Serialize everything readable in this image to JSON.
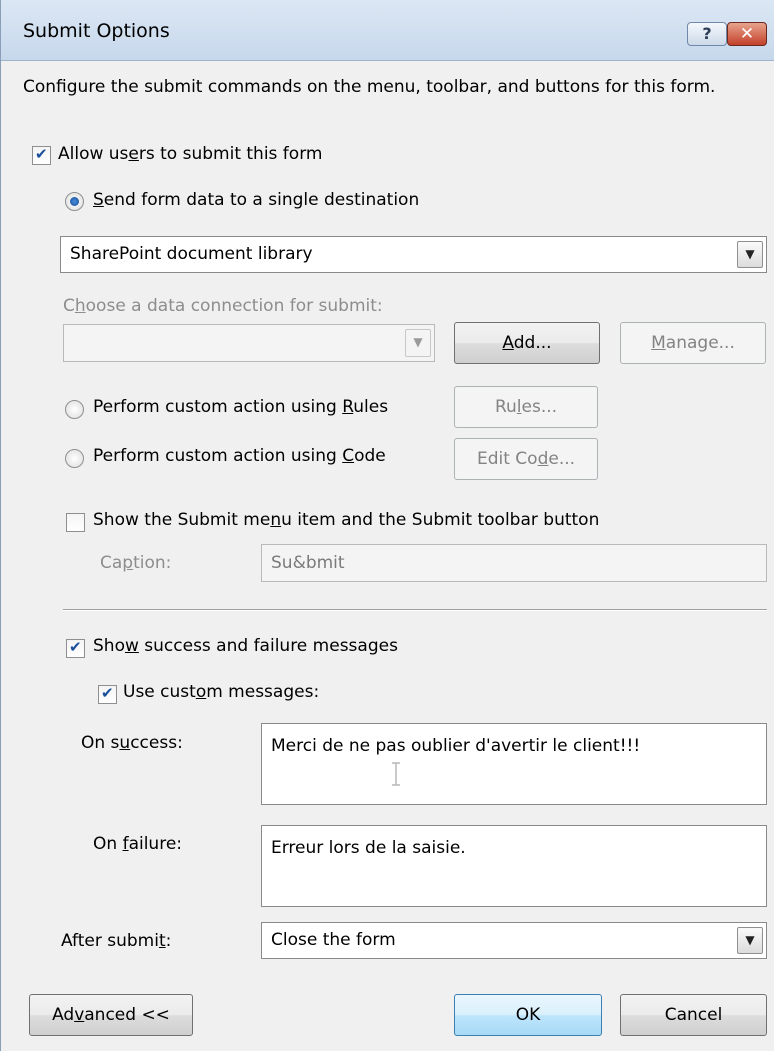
{
  "window": {
    "title": "Submit Options",
    "help_label": "?",
    "close_label": "✕"
  },
  "description": "Configure the submit commands on the menu, toolbar, and buttons for this form.",
  "allow_submit": {
    "label_pre": "Allow us",
    "label_acc": "e",
    "label_post": "rs to submit this form",
    "checked": true
  },
  "send_single": {
    "label_pre": "",
    "label_acc": "S",
    "label_post": "end form data to a single destination",
    "selected": true
  },
  "destination": {
    "value": "SharePoint document library"
  },
  "data_connection": {
    "label_pre": "C",
    "label_acc": "h",
    "label_post": "oose a data connection for submit:",
    "value": ""
  },
  "buttons": {
    "add_pre": "",
    "add_acc": "A",
    "add_post": "dd...",
    "manage_pre": "",
    "manage_acc": "M",
    "manage_post": "anage...",
    "rules_pre": "Ru",
    "rules_acc": "l",
    "rules_post": "es...",
    "edit_code_pre": "Edit Co",
    "edit_code_acc": "d",
    "edit_code_post": "e...",
    "advanced_pre": "Ad",
    "advanced_acc": "v",
    "advanced_post": "anced <<",
    "ok": "OK",
    "cancel": "Cancel"
  },
  "custom_rules": {
    "label_pre": "Perform custom action using ",
    "label_acc": "R",
    "label_post": "ules",
    "selected": false
  },
  "custom_code": {
    "label_pre": "Perform custom action using ",
    "label_acc": "C",
    "label_post": "ode",
    "selected": false
  },
  "show_submit_menu": {
    "label_pre": "Show the Submit me",
    "label_acc": "n",
    "label_post": "u item and the Submit toolbar button",
    "checked": false
  },
  "caption": {
    "label_pre": "Ca",
    "label_acc": "p",
    "label_post": "tion:",
    "value": "Su&bmit"
  },
  "show_messages": {
    "label_pre": "Sho",
    "label_acc": "w",
    "label_post": " success and failure messages",
    "checked": true
  },
  "custom_messages": {
    "label_pre": "Use cust",
    "label_acc": "o",
    "label_post": "m messages:",
    "checked": true
  },
  "on_success": {
    "label_pre": "On s",
    "label_acc": "u",
    "label_post": "ccess:",
    "value": "Merci de ne pas oublier d'avertir le client!!!"
  },
  "on_failure": {
    "label_pre": "On ",
    "label_acc": "f",
    "label_post": "ailure:",
    "value": "Erreur lors de la saisie."
  },
  "after_submit": {
    "label_pre": "After submi",
    "label_acc": "t",
    "label_post": ":",
    "value": "Close the form"
  }
}
